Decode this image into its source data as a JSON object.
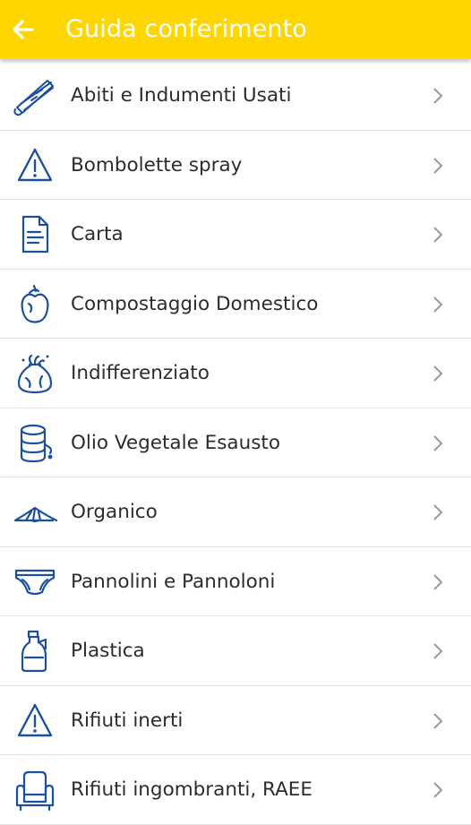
{
  "appbar": {
    "title": "Guida conferimento",
    "back_icon": "arrow-left-icon",
    "color": "#ffd600"
  },
  "list": {
    "items": [
      {
        "label": "Abiti e Indumenti Usati",
        "icon": "clothes-hanger-icon"
      },
      {
        "label": "Bombolette spray",
        "icon": "warning-triangle-icon"
      },
      {
        "label": "Carta",
        "icon": "paper-document-icon"
      },
      {
        "label": "Compostaggio Domestico",
        "icon": "apple-core-icon"
      },
      {
        "label": "Indifferenziato",
        "icon": "trash-bag-icon"
      },
      {
        "label": "Olio Vegetale Esausto",
        "icon": "oil-drum-icon"
      },
      {
        "label": "Organico",
        "icon": "fish-bones-icon"
      },
      {
        "label": "Pannolini e Pannoloni",
        "icon": "diaper-icon"
      },
      {
        "label": "Plastica",
        "icon": "plastic-bottle-icon"
      },
      {
        "label": "Rifiuti inerti",
        "icon": "warning-triangle-icon"
      },
      {
        "label": "Rifiuti ingombranti, RAEE",
        "icon": "armchair-icon"
      }
    ],
    "icon_color": "#1c4fa0",
    "chevron_icon": "chevron-right-icon"
  }
}
